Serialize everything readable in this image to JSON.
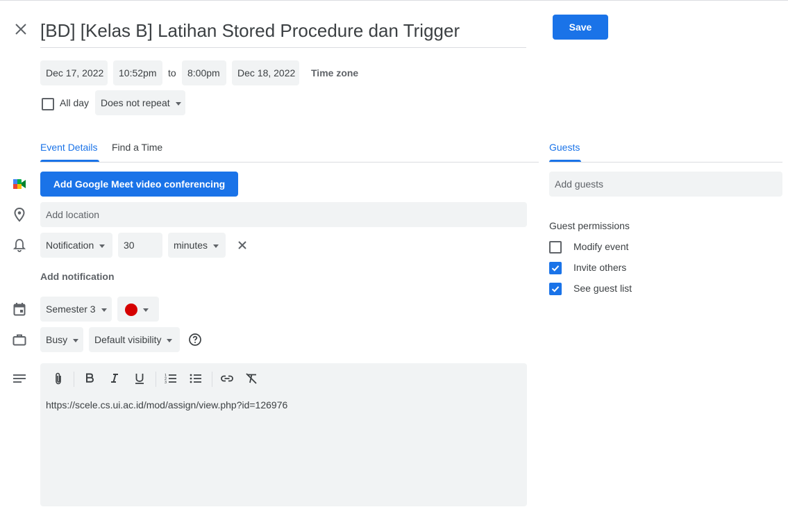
{
  "event": {
    "title": "[BD] [Kelas B] Latihan Stored Procedure dan Trigger",
    "save_label": "Save",
    "start_date": "Dec 17, 2022",
    "start_time": "10:52pm",
    "to_label": "to",
    "end_time": "8:00pm",
    "end_date": "Dec 18, 2022",
    "timezone_label": "Time zone",
    "all_day_label": "All day",
    "all_day_checked": false,
    "repeat_value": "Does not repeat"
  },
  "tabs": [
    {
      "label": "Event Details",
      "active": true
    },
    {
      "label": "Find a Time",
      "active": false
    }
  ],
  "details": {
    "meet_button_label": "Add Google Meet video conferencing",
    "location_placeholder": "Add location",
    "notification": {
      "type": "Notification",
      "amount": "30",
      "unit": "minutes"
    },
    "add_notification_label": "Add notification",
    "calendar_name": "Semester 3",
    "calendar_color": "#d50000",
    "availability": "Busy",
    "visibility": "Default visibility",
    "description": "https://scele.cs.ui.ac.id/mod/assign/view.php?id=126976",
    "toolbar_icons": [
      "attachment-icon",
      "bold-icon",
      "italic-icon",
      "underline-icon",
      "numbered-list-icon",
      "bulleted-list-icon",
      "link-icon",
      "remove-formatting-icon"
    ]
  },
  "guests": {
    "tab_label": "Guests",
    "add_placeholder": "Add guests",
    "permissions_title": "Guest permissions",
    "permissions": [
      {
        "label": "Modify event",
        "checked": false
      },
      {
        "label": "Invite others",
        "checked": true
      },
      {
        "label": "See guest list",
        "checked": true
      }
    ]
  },
  "colors": {
    "accent": "#1a73e8",
    "field_bg": "#f1f3f4",
    "text": "#3c4043"
  }
}
